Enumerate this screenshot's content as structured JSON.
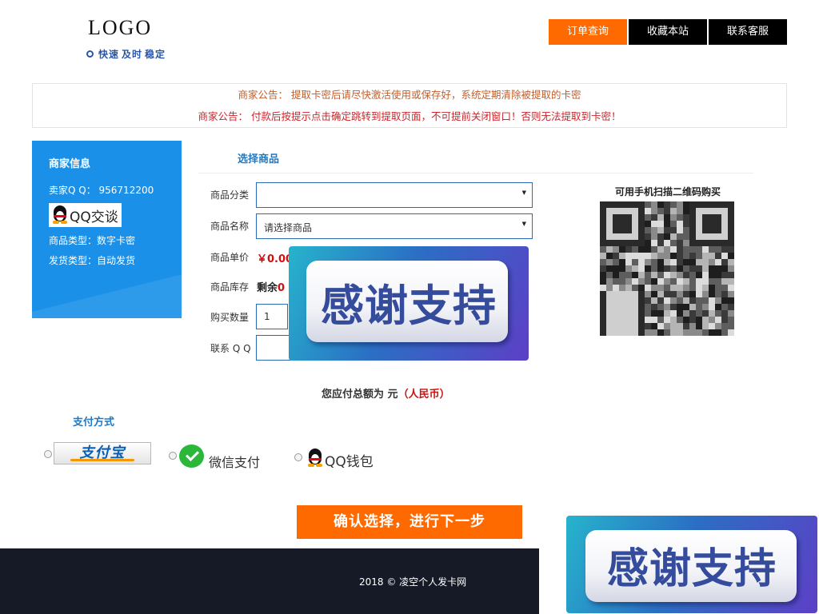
{
  "header": {
    "logo": "LOGO",
    "slogan": [
      "快速",
      "及时",
      "稳定"
    ],
    "nav": [
      {
        "label": "订单查询",
        "active": true
      },
      {
        "label": "收藏本站",
        "active": false
      },
      {
        "label": "联系客服",
        "active": false
      }
    ]
  },
  "notices": [
    "商家公告：  提取卡密后请尽快激活使用或保存好，系统定期清除被提取的卡密",
    "商家公告：  付款后按提示点击确定跳转到提取页面，不可提前关闭窗口！否则无法提取到卡密！"
  ],
  "merchant": {
    "title": "商家信息",
    "qq": "卖家Q Q：  956712200",
    "qq_chat": "QQ交谈",
    "product_type": "商品类型：数字卡密",
    "delivery_type": "发货类型：自动发货"
  },
  "select_goods": {
    "title": "选择商品",
    "category_label": "商品分类",
    "category_value": "",
    "name_label": "商品名称",
    "name_value": "请选择商品",
    "price_label": "商品单价",
    "price_value": "￥0.00",
    "stock_label": "商品库存",
    "stock_prefix": "剩余",
    "stock_value": "0",
    "qty_label": "购买数量",
    "qty_value": "1",
    "contact_label": "联系 Q Q",
    "contact_value": ""
  },
  "banner": {
    "text": "感谢支持"
  },
  "qr": {
    "label": "可用手机扫描二维码购买"
  },
  "total": {
    "prefix": "您应付总额为",
    "unit": "元",
    "currency": "（人民币）"
  },
  "payment": {
    "title": "支付方式",
    "alipay": "支付宝",
    "wechat": "微信支付",
    "qqwallet": "QQ钱包"
  },
  "confirm_label": "确认选择，进行下一步",
  "footer": {
    "text": "2018 © 凌空个人发卡网"
  },
  "colors": {
    "accent": "#ff6a00",
    "merchant_bg": "#1a90e8",
    "link_blue": "#1f7ac6",
    "footer_bg": "#151a26",
    "price_red": "#cc1111"
  }
}
